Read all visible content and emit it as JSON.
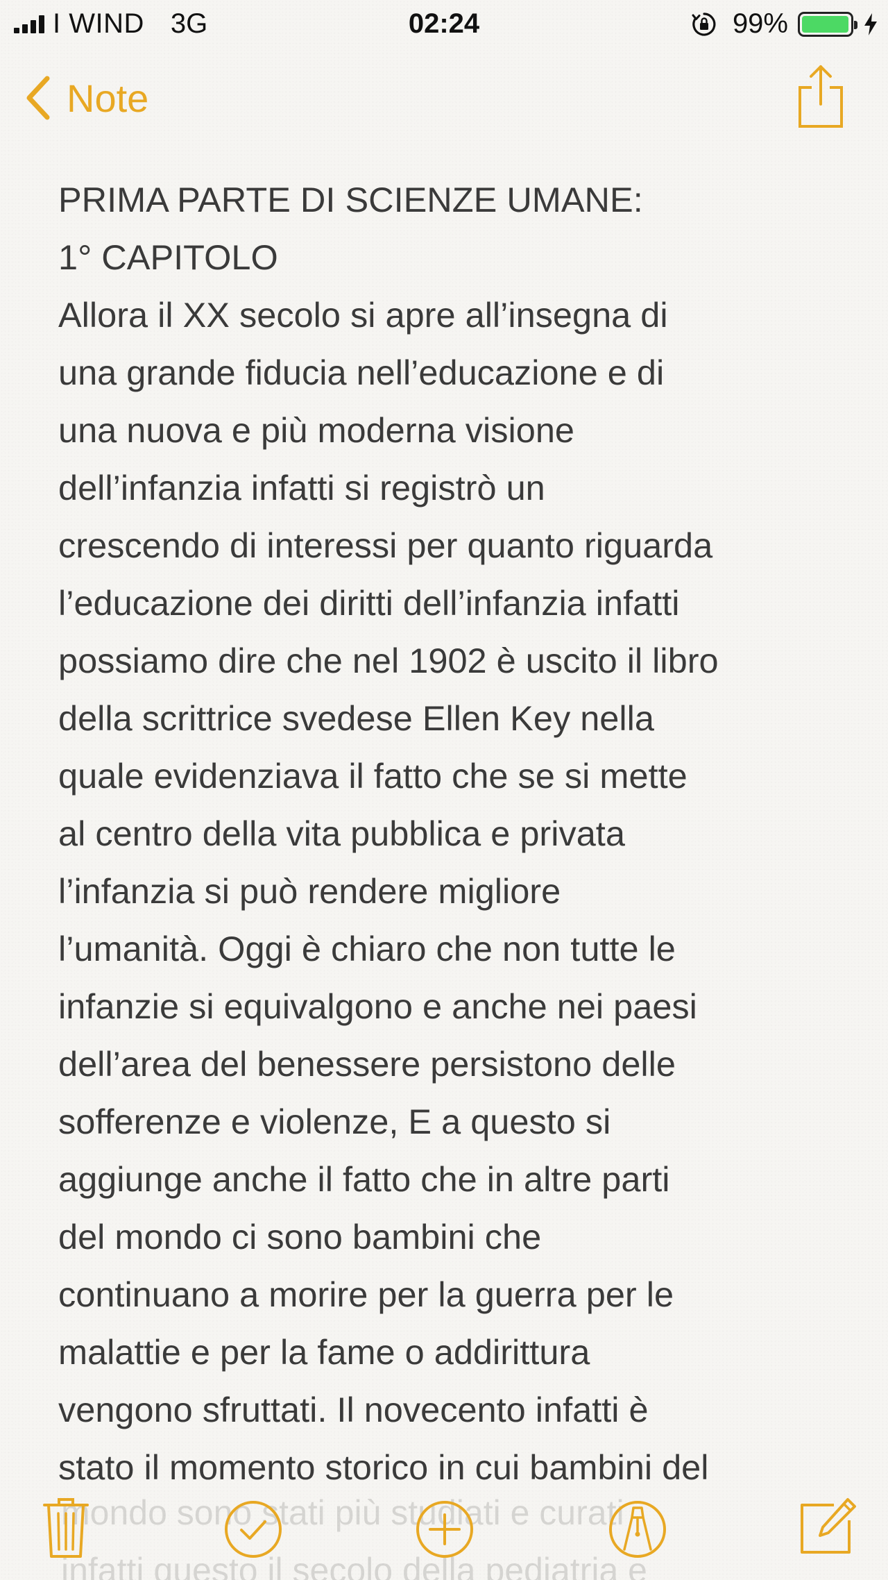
{
  "status_bar": {
    "carrier": "I WIND",
    "network": "3G",
    "time": "02:24",
    "battery_percent": "99%",
    "battery_level": 0.99
  },
  "nav": {
    "back_label": "Note"
  },
  "note": {
    "lines": [
      "PRIMA PARTE DI SCIENZE UMANE:",
      "1° CAPITOLO",
      "Allora il XX secolo si apre all’insegna di",
      "una grande fiducia nell’educazione e di",
      "una nuova e più moderna visione",
      "dell’infanzia infatti si registrò un",
      "crescendo di interessi per quanto riguarda",
      "l’educazione dei diritti dell’infanzia infatti",
      "possiamo dire che nel 1902 è uscito il libro",
      "della scrittrice svedese Ellen Key nella",
      "quale evidenziava il fatto che se si mette",
      "al centro della vita pubblica e privata",
      "l’infanzia si può rendere migliore",
      "l’umanità. Oggi è chiaro che non tutte le",
      "infanzie si equivalgono e anche nei paesi",
      "dell’area del benessere persistono delle",
      "sofferenze e violenze, E a questo si",
      "aggiunge anche il fatto che in altre parti",
      "del mondo ci sono bambini che",
      "continuano a morire per la guerra per le",
      "malattie e per la fame o addirittura",
      "vengono sfruttati. Il novecento infatti è",
      "stato il momento storico in cui bambini del"
    ],
    "faded_lines": [
      "mondo sono stati più studiati e curati",
      "infatti questo il secolo della pediatria e"
    ]
  },
  "colors": {
    "accent": "#e8a823",
    "text": "#3a3a3a",
    "background": "#f6f5f2",
    "battery": "#4cd964"
  },
  "icons": {
    "back": "chevron-left-icon",
    "share": "share-icon",
    "trash": "trash-icon",
    "checklist": "checkmark-circle-icon",
    "add": "plus-circle-icon",
    "sketch": "pen-tip-circle-icon",
    "compose": "compose-icon"
  }
}
